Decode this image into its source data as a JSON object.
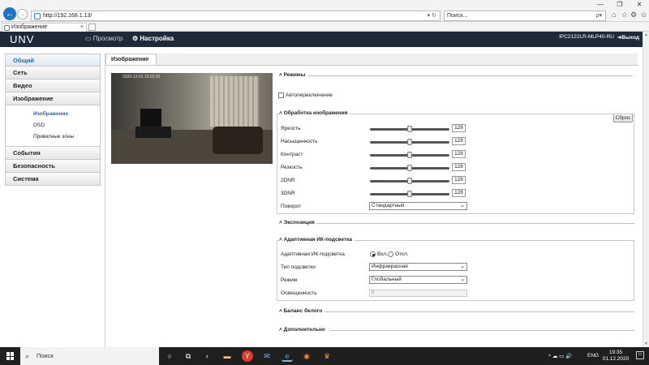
{
  "browser": {
    "url": "http://192.168.1.13/",
    "url_tools": "▾ ↻",
    "search_placeholder": "Поиск...",
    "search_tools": "ρ▾",
    "tab_title": "Изображение",
    "tab_close": "×"
  },
  "header": {
    "logo": "UNV",
    "nav_preview": "Просмотр",
    "nav_settings": "Настройка",
    "model": "IPC2122LR-MLP40-RU",
    "logout": "Выход"
  },
  "sidebar": {
    "items": [
      {
        "label": "Общий"
      },
      {
        "label": "Сеть"
      },
      {
        "label": "Видео"
      },
      {
        "label": "Изображение"
      },
      {
        "label": "События"
      },
      {
        "label": "Безопасность"
      },
      {
        "label": "Система"
      }
    ],
    "subitems": [
      {
        "label": "Изображение"
      },
      {
        "label": "OSD"
      },
      {
        "label": "Приватные зоны"
      }
    ]
  },
  "main": {
    "tab": "Изображение",
    "video_osd": "2020-12-01 19:35:02",
    "modes": {
      "title": "Режимы",
      "auto_switch": "Автопереключение",
      "auto_switch_checked": false,
      "reset": "Сброс"
    },
    "image_processing": {
      "title": "Обработка изображения",
      "rows": [
        {
          "label": "Яркость",
          "value": "128",
          "level": 0.5
        },
        {
          "label": "Насыщенность",
          "value": "128",
          "level": 0.5
        },
        {
          "label": "Контраст",
          "value": "128",
          "level": 0.5
        },
        {
          "label": "Резкость",
          "value": "128",
          "level": 0.5
        },
        {
          "label": "2DNR",
          "value": "128",
          "level": 0.5
        },
        {
          "label": "3DNR",
          "value": "128",
          "level": 0.5
        }
      ],
      "rotation_label": "Поворот",
      "rotation_value": "Стандартный"
    },
    "exposure": {
      "title": "Экспозиция"
    },
    "ir": {
      "title": "Адаптивная ИК-подсветка",
      "adaptive_label": "Адаптивная ИК-подсветка",
      "on": "Вкл.",
      "off": "Откл.",
      "selected": "on",
      "type_label": "Тип подсветки",
      "type_value": "Инфракрасная",
      "mode_label": "Режим",
      "mode_value": "Глобальный",
      "lux_label": "Освещенность",
      "lux_value": "0"
    },
    "white_balance": {
      "title": "Баланс белого"
    },
    "advanced": {
      "title": "Дополнительно"
    }
  },
  "taskbar": {
    "search": "Поиск",
    "lang": "ENG",
    "time": "19:35",
    "date": "01.12.2020",
    "tray_icons": "^ ☁ ▭ 🔊"
  }
}
